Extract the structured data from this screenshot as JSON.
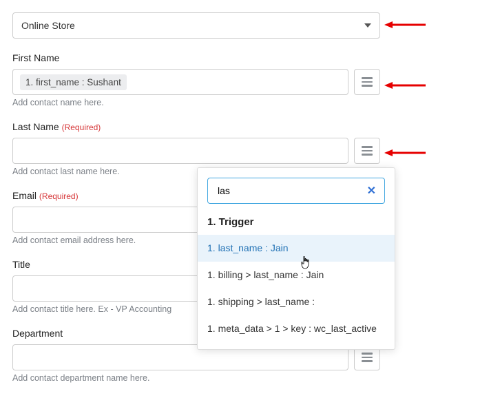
{
  "topSelect": {
    "value": "Online Store"
  },
  "fields": {
    "firstName": {
      "label": "First Name",
      "tag": "1. first_name : Sushant",
      "helper": "Add contact name here."
    },
    "lastName": {
      "label": "Last Name",
      "required": "(Required)",
      "helper": "Add contact last name here."
    },
    "email": {
      "label": "Email",
      "required": "(Required)",
      "helper": "Add contact email address here."
    },
    "title": {
      "label": "Title",
      "helper": "Add contact title here. Ex - VP Accounting"
    },
    "department": {
      "label": "Department",
      "helper": "Add contact department name here."
    }
  },
  "dropdown": {
    "search": "las",
    "heading": "1. Trigger",
    "items": [
      "1. last_name : Jain",
      "1. billing > last_name : Jain",
      "1. shipping > last_name :",
      "1. meta_data > 1 > key : wc_last_active"
    ]
  }
}
